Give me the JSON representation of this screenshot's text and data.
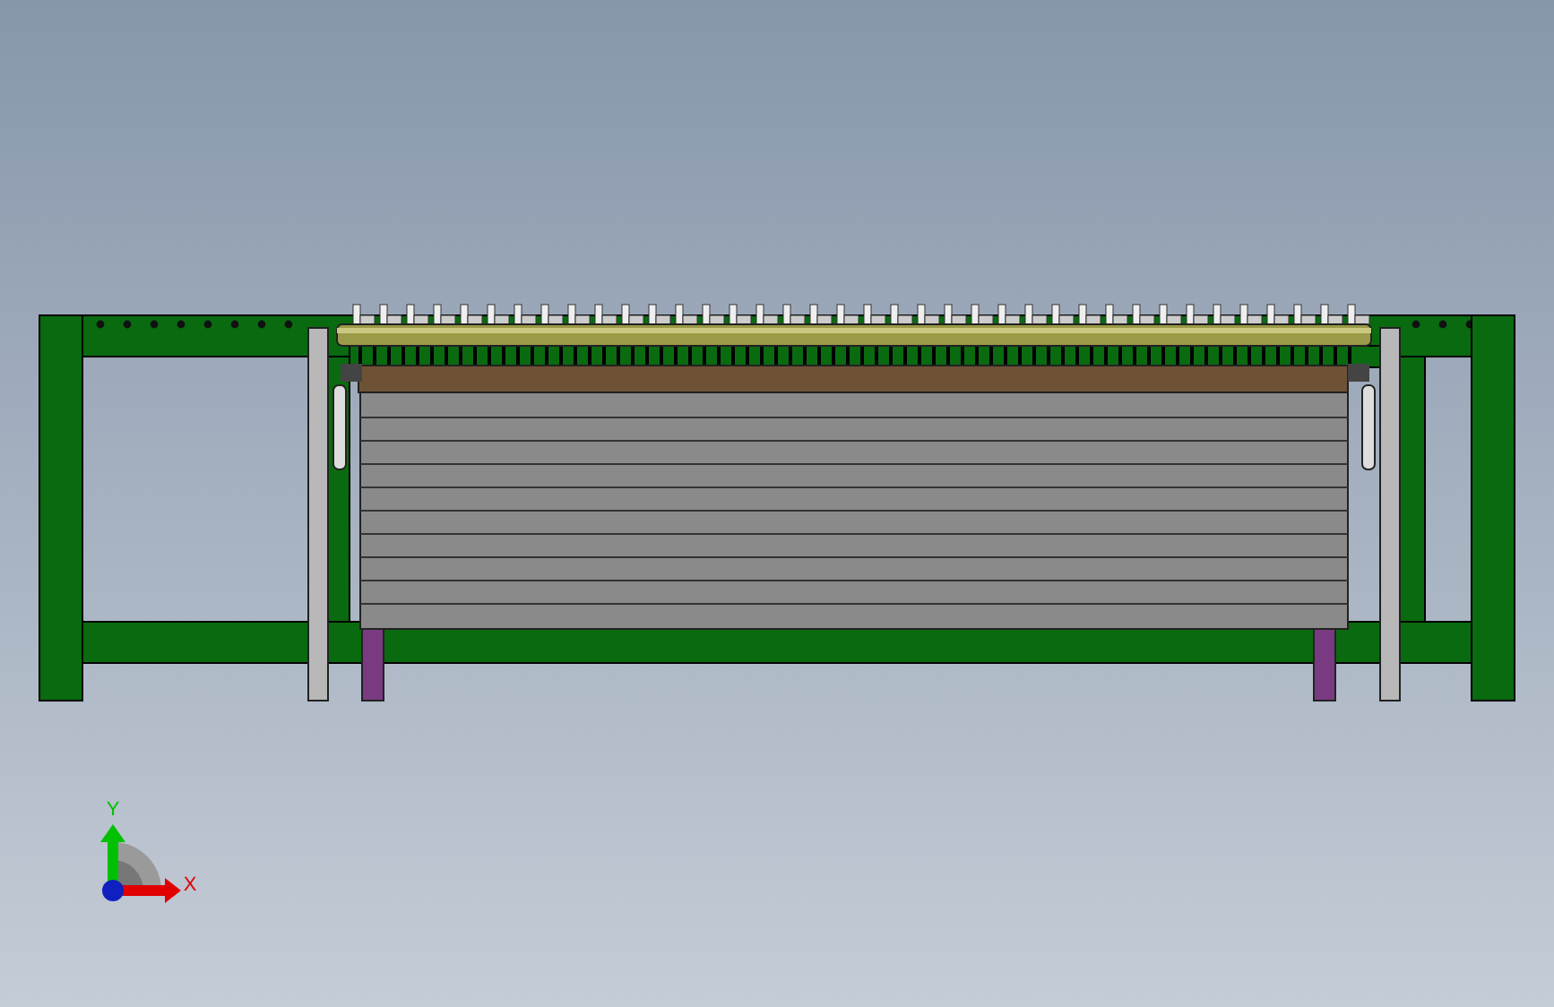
{
  "viewport": {
    "triad": {
      "axes": [
        {
          "label": "Y",
          "color": "#00c000"
        },
        {
          "label": "X",
          "color": "#e00000"
        }
      ]
    }
  }
}
